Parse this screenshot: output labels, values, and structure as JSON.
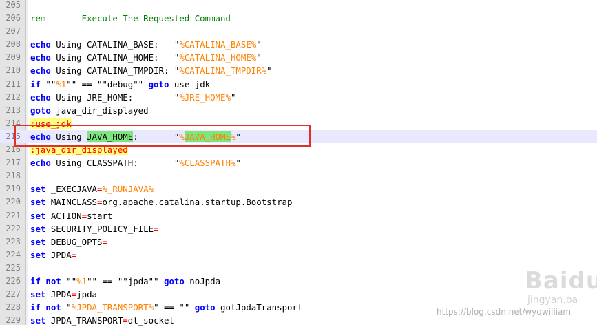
{
  "editor": {
    "lines": [
      {
        "n": "205",
        "tokens": []
      },
      {
        "n": "206",
        "tokens": [
          {
            "t": "rem ----- Execute The Requested Command ---------------------------------------",
            "c": "cm"
          }
        ]
      },
      {
        "n": "207",
        "tokens": []
      },
      {
        "n": "208",
        "tokens": [
          {
            "t": "echo",
            "c": "kw"
          },
          {
            "t": " Using CATALINA_BASE:   \"",
            "c": "tx"
          },
          {
            "t": "%CATALINA_BASE%",
            "c": "var"
          },
          {
            "t": "\"",
            "c": "tx"
          }
        ]
      },
      {
        "n": "209",
        "tokens": [
          {
            "t": "echo",
            "c": "kw"
          },
          {
            "t": " Using CATALINA_HOME:   \"",
            "c": "tx"
          },
          {
            "t": "%CATALINA_HOME%",
            "c": "var"
          },
          {
            "t": "\"",
            "c": "tx"
          }
        ]
      },
      {
        "n": "210",
        "tokens": [
          {
            "t": "echo",
            "c": "kw"
          },
          {
            "t": " Using CATALINA_TMPDIR: \"",
            "c": "tx"
          },
          {
            "t": "%CATALINA_TMPDIR%",
            "c": "var"
          },
          {
            "t": "\"",
            "c": "tx"
          }
        ]
      },
      {
        "n": "211",
        "tokens": [
          {
            "t": "if",
            "c": "kw"
          },
          {
            "t": " \"\"",
            "c": "tx"
          },
          {
            "t": "%1",
            "c": "var"
          },
          {
            "t": "\"\" == \"\"debug\"\" ",
            "c": "tx"
          },
          {
            "t": "goto",
            "c": "kw"
          },
          {
            "t": " use_jdk",
            "c": "tx"
          }
        ]
      },
      {
        "n": "212",
        "tokens": [
          {
            "t": "echo",
            "c": "kw"
          },
          {
            "t": " Using JRE_HOME:        \"",
            "c": "tx"
          },
          {
            "t": "%JRE_HOME%",
            "c": "var"
          },
          {
            "t": "\"",
            "c": "tx"
          }
        ]
      },
      {
        "n": "213",
        "tokens": [
          {
            "t": "goto",
            "c": "kw"
          },
          {
            "t": " java_dir_displayed",
            "c": "tx"
          }
        ]
      },
      {
        "n": "214",
        "tokens": [
          {
            "t": ":use_jdk",
            "c": "lbl"
          }
        ]
      },
      {
        "n": "215",
        "current": true,
        "tokens": [
          {
            "t": "echo",
            "c": "kw"
          },
          {
            "t": " Using ",
            "c": "tx"
          },
          {
            "t": "JAVA_HOME",
            "c": "tx sel"
          },
          {
            "t": ":       \"",
            "c": "tx"
          },
          {
            "t": "%",
            "c": "var"
          },
          {
            "t": "JAVA_HOME",
            "c": "var sel"
          },
          {
            "t": "%",
            "c": "var"
          },
          {
            "t": "\"",
            "c": "tx"
          }
        ]
      },
      {
        "n": "216",
        "tokens": [
          {
            "t": ":java_dir_displayed",
            "c": "lbl"
          }
        ]
      },
      {
        "n": "217",
        "tokens": [
          {
            "t": "echo",
            "c": "kw"
          },
          {
            "t": " Using CLASSPATH:       \"",
            "c": "tx"
          },
          {
            "t": "%CLASSPATH%",
            "c": "var"
          },
          {
            "t": "\"",
            "c": "tx"
          }
        ]
      },
      {
        "n": "218",
        "tokens": []
      },
      {
        "n": "219",
        "tokens": [
          {
            "t": "set",
            "c": "kw"
          },
          {
            "t": " _EXECJAVA",
            "c": "tx"
          },
          {
            "t": "=",
            "c": "op"
          },
          {
            "t": "%_RUNJAVA%",
            "c": "var"
          }
        ]
      },
      {
        "n": "220",
        "tokens": [
          {
            "t": "set",
            "c": "kw"
          },
          {
            "t": " MAINCLASS",
            "c": "tx"
          },
          {
            "t": "=",
            "c": "op"
          },
          {
            "t": "org.apache.catalina.startup.Bootstrap",
            "c": "tx"
          }
        ]
      },
      {
        "n": "221",
        "tokens": [
          {
            "t": "set",
            "c": "kw"
          },
          {
            "t": " ACTION",
            "c": "tx"
          },
          {
            "t": "=",
            "c": "op"
          },
          {
            "t": "start",
            "c": "tx"
          }
        ]
      },
      {
        "n": "222",
        "tokens": [
          {
            "t": "set",
            "c": "kw"
          },
          {
            "t": " SECURITY_POLICY_FILE",
            "c": "tx"
          },
          {
            "t": "=",
            "c": "op"
          }
        ]
      },
      {
        "n": "223",
        "tokens": [
          {
            "t": "set",
            "c": "kw"
          },
          {
            "t": " DEBUG_OPTS",
            "c": "tx"
          },
          {
            "t": "=",
            "c": "op"
          }
        ]
      },
      {
        "n": "224",
        "tokens": [
          {
            "t": "set",
            "c": "kw"
          },
          {
            "t": " JPDA",
            "c": "tx"
          },
          {
            "t": "=",
            "c": "op"
          }
        ]
      },
      {
        "n": "225",
        "tokens": []
      },
      {
        "n": "226",
        "tokens": [
          {
            "t": "if",
            "c": "kw"
          },
          {
            "t": " ",
            "c": "tx"
          },
          {
            "t": "not",
            "c": "kw"
          },
          {
            "t": " \"\"",
            "c": "tx"
          },
          {
            "t": "%1",
            "c": "var"
          },
          {
            "t": "\"\" == \"\"jpda\"\" ",
            "c": "tx"
          },
          {
            "t": "goto",
            "c": "kw"
          },
          {
            "t": " noJpda",
            "c": "tx"
          }
        ]
      },
      {
        "n": "227",
        "tokens": [
          {
            "t": "set",
            "c": "kw"
          },
          {
            "t": " JPDA",
            "c": "tx"
          },
          {
            "t": "=",
            "c": "op"
          },
          {
            "t": "jpda",
            "c": "tx"
          }
        ]
      },
      {
        "n": "228",
        "tokens": [
          {
            "t": "if",
            "c": "kw"
          },
          {
            "t": " ",
            "c": "tx"
          },
          {
            "t": "not",
            "c": "kw"
          },
          {
            "t": " \"",
            "c": "tx"
          },
          {
            "t": "%JPDA_TRANSPORT%",
            "c": "var"
          },
          {
            "t": "\" == \"\" ",
            "c": "tx"
          },
          {
            "t": "goto",
            "c": "kw"
          },
          {
            "t": " gotJpdaTransport",
            "c": "tx"
          }
        ]
      },
      {
        "n": "229",
        "tokens": [
          {
            "t": "set",
            "c": "kw"
          },
          {
            "t": " JPDA_TRANSPORT",
            "c": "tx"
          },
          {
            "t": "=",
            "c": "op"
          },
          {
            "t": "dt_socket",
            "c": "tx"
          }
        ]
      }
    ]
  },
  "colors": {
    "keyword": "#0000ff",
    "variable": "#ff8000",
    "operator": "#ff0000",
    "label": "#ff0000",
    "label_background": "#ffff80",
    "comment": "#008000",
    "selection": "#7fe57f",
    "callout_border": "#e0302e"
  },
  "watermark": {
    "brand": "Baidu",
    "site": "jingyan.ba",
    "url": "https://blog.csdn.net/wyqwilliam"
  }
}
